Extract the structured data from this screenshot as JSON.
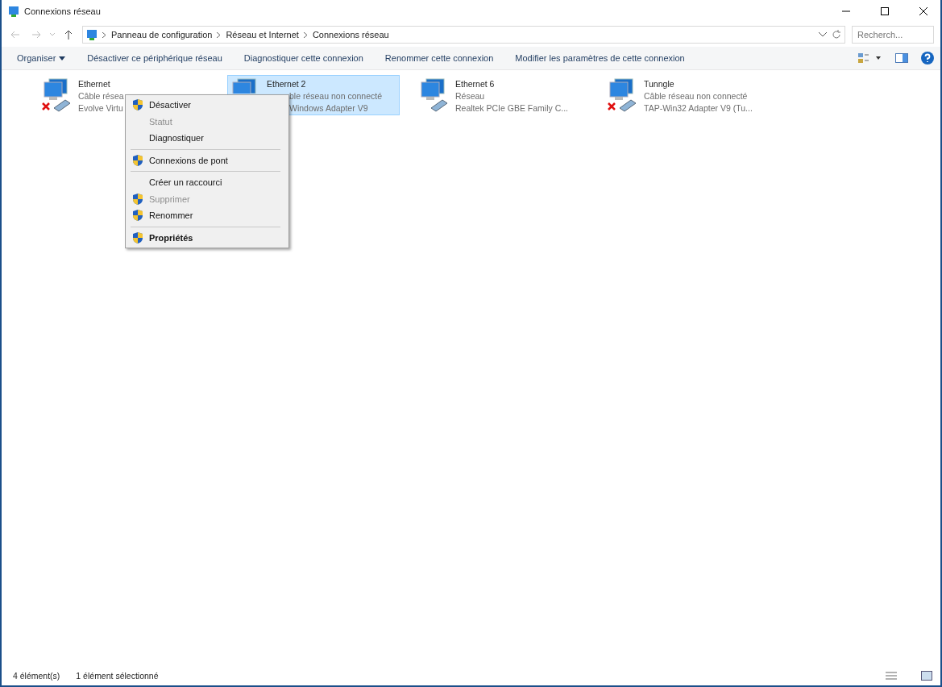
{
  "window": {
    "title": "Connexions réseau"
  },
  "breadcrumb": [
    "Panneau de configuration",
    "Réseau et Internet",
    "Connexions réseau"
  ],
  "search": {
    "placeholder": "Recherch..."
  },
  "toolbar": [
    "Organiser",
    "Désactiver ce périphérique réseau",
    "Diagnostiquer cette connexion",
    "Renommer cette connexion",
    "Modifier les paramètres de cette connexion"
  ],
  "connections": [
    {
      "name": "Ethernet",
      "status": "Câble résea",
      "adapter": "Evolve Virtu",
      "disconnected": true,
      "selected": false,
      "cut": false
    },
    {
      "name": "Ethernet 2",
      "status": "ble réseau non connecté",
      "adapter": "Windows Adapter V9",
      "disconnected": false,
      "selected": true,
      "cut": true
    },
    {
      "name": "Ethernet 6",
      "status": "Réseau",
      "adapter": "Realtek PCIe GBE Family C...",
      "disconnected": false,
      "selected": false,
      "cut": false
    },
    {
      "name": "Tunngle",
      "status": "Câble réseau non connecté",
      "adapter": "TAP-Win32 Adapter V9 (Tu...",
      "disconnected": true,
      "selected": false,
      "cut": false
    }
  ],
  "context_menu": [
    {
      "kind": "item",
      "label": "Désactiver",
      "shield": true,
      "disabled": false,
      "bold": false
    },
    {
      "kind": "item",
      "label": "Statut",
      "shield": false,
      "disabled": true,
      "bold": false
    },
    {
      "kind": "item",
      "label": "Diagnostiquer",
      "shield": false,
      "disabled": false,
      "bold": false
    },
    {
      "kind": "separator"
    },
    {
      "kind": "item",
      "label": "Connexions de pont",
      "shield": true,
      "disabled": false,
      "bold": false
    },
    {
      "kind": "separator"
    },
    {
      "kind": "item",
      "label": "Créer un raccourci",
      "shield": false,
      "disabled": false,
      "bold": false
    },
    {
      "kind": "item",
      "label": "Supprimer",
      "shield": true,
      "disabled": true,
      "bold": false
    },
    {
      "kind": "item",
      "label": "Renommer",
      "shield": true,
      "disabled": false,
      "bold": false
    },
    {
      "kind": "separator"
    },
    {
      "kind": "item",
      "label": "Propriétés",
      "shield": true,
      "disabled": false,
      "bold": true
    }
  ],
  "status_bar": {
    "count": "4 élément(s)",
    "selection": "1 élément sélectionné"
  }
}
